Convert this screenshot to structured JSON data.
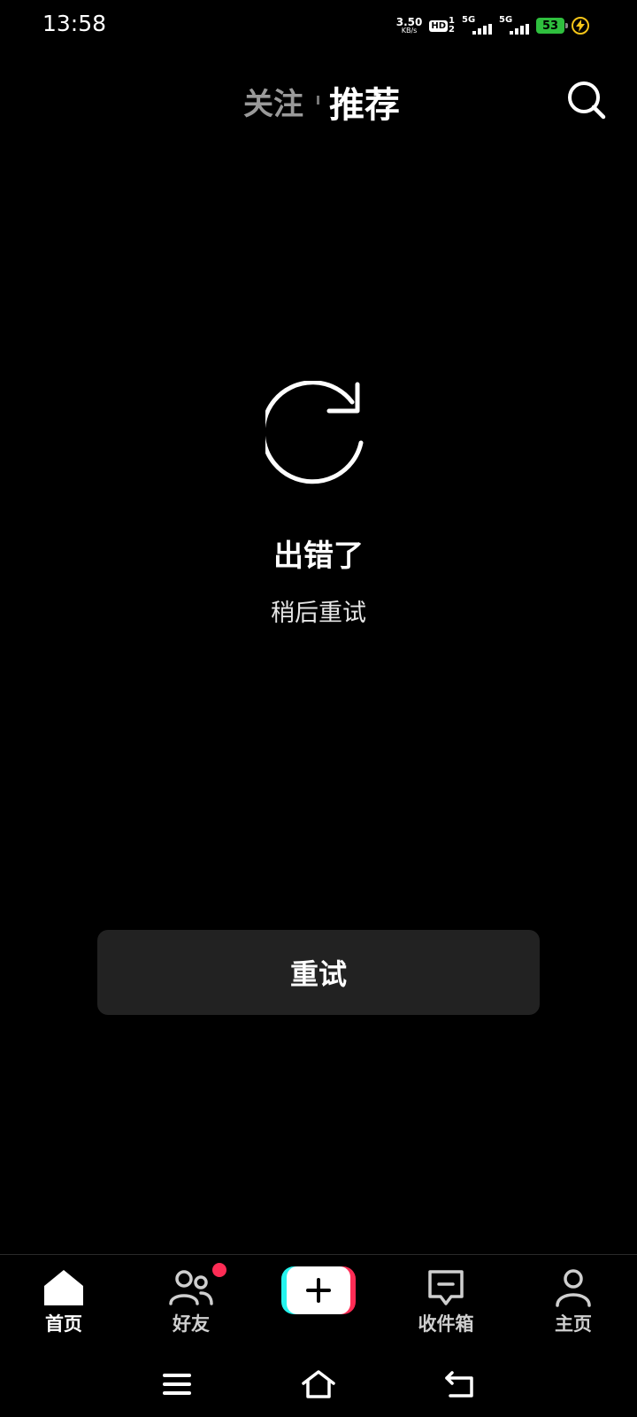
{
  "status_bar": {
    "time": "13:58",
    "net_speed_value": "3.50",
    "net_speed_unit": "KB/s",
    "hd_label": "HD",
    "hd_sup": "1",
    "hd_sub": "2",
    "sim1_label": "5G",
    "sim2_label": "5G",
    "battery_percent": "53",
    "battery_color": "#2fbf3e",
    "charging_color": "#f5c518"
  },
  "top_tabs": {
    "follow": "关注",
    "recommend": "推荐",
    "search_icon": "search-icon"
  },
  "error": {
    "icon": "reload-icon",
    "title": "出错了",
    "subtitle": "稍后重试",
    "retry_label": "重试"
  },
  "bottom_nav": {
    "items": [
      {
        "label": "首页",
        "icon": "home-icon",
        "active": true
      },
      {
        "label": "好友",
        "icon": "friends-icon",
        "badge": true
      },
      {
        "label": "",
        "icon": "create-icon"
      },
      {
        "label": "收件箱",
        "icon": "inbox-icon"
      },
      {
        "label": "主页",
        "icon": "profile-icon"
      }
    ],
    "badge_color": "#fe2c55",
    "create_colors": {
      "left": "#25f4ee",
      "right": "#fe2c55"
    }
  },
  "system_nav": {
    "menu_icon": "menu-icon",
    "home_icon": "home-outline-icon",
    "back_icon": "back-icon"
  }
}
